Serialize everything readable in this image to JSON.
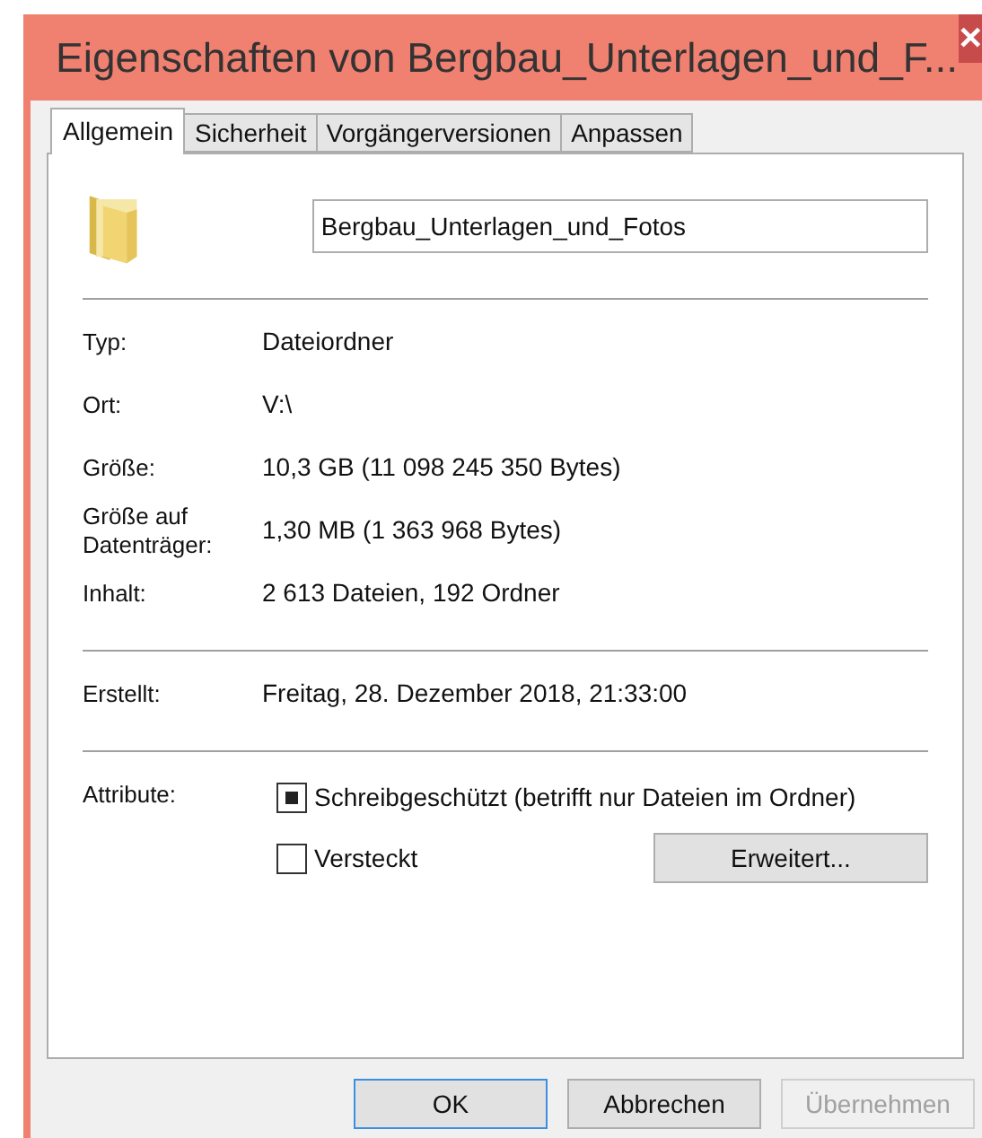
{
  "window": {
    "title": "Eigenschaften von Bergbau_Unterlagen_und_F...",
    "close": "✕"
  },
  "tabs": [
    {
      "label": "Allgemein",
      "selected": true
    },
    {
      "label": "Sicherheit",
      "selected": false
    },
    {
      "label": "Vorgängerversionen",
      "selected": false
    },
    {
      "label": "Anpassen",
      "selected": false
    }
  ],
  "name_field": {
    "value": "Bergbau_Unterlagen_und_Fotos"
  },
  "sections": [
    [
      {
        "label": "Typ:",
        "value": "Dateiordner"
      },
      {
        "label": "Ort:",
        "value": "V:\\"
      },
      {
        "label": "Größe:",
        "value": "10,3 GB (11 098 245 350 Bytes)"
      },
      {
        "label": "Größe auf Datenträger:",
        "value": "1,30 MB (1 363 968 Bytes)"
      },
      {
        "label": "Inhalt:",
        "value": "2 613 Dateien, 192 Ordner"
      }
    ],
    [
      {
        "label": "Erstellt:",
        "value": "Freitag, 28. Dezember 2018, 21:33:00"
      }
    ]
  ],
  "attributes": {
    "label": "Attribute:",
    "items": [
      {
        "label": "Schreibgeschützt (betrifft nur Dateien im Ordner)",
        "kind": "indeterminate"
      },
      {
        "label": "Versteckt",
        "kind": "unchecked"
      }
    ],
    "advanced_button": "Erweitert..."
  },
  "buttons": [
    {
      "label": "OK",
      "default": true,
      "disabled": false
    },
    {
      "label": "Abbrechen",
      "default": false,
      "disabled": false
    },
    {
      "label": "Übernehmen",
      "default": false,
      "disabled": true
    }
  ]
}
